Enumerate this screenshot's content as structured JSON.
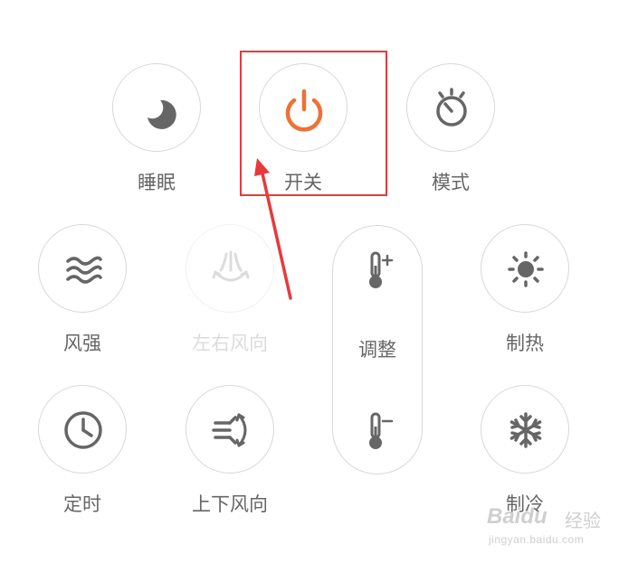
{
  "colors": {
    "icon_gray": "#7a7a7a",
    "power_orange": "#ec7236",
    "border_gray": "#d8d8d8",
    "disabled_gray": "#dcdcdc",
    "annotation_red": "#e8393d"
  },
  "controls": {
    "sleep": {
      "label": "睡眠",
      "icon": "moon-icon"
    },
    "power": {
      "label": "开关",
      "icon": "power-icon"
    },
    "mode": {
      "label": "模式",
      "icon": "stopwatch-icon"
    },
    "wind_strength": {
      "label": "风强",
      "icon": "wind-waves-icon"
    },
    "horizontal_swing": {
      "label": "左右风向",
      "icon": "horizontal-swing-icon",
      "disabled": true
    },
    "heat": {
      "label": "制热",
      "icon": "sun-icon"
    },
    "timer": {
      "label": "定时",
      "icon": "clock-icon"
    },
    "vertical_swing": {
      "label": "上下风向",
      "icon": "vertical-swing-icon"
    },
    "cool": {
      "label": "制冷",
      "icon": "snowflake-icon"
    },
    "temperature": {
      "label": "调整",
      "up_icon": "thermometer-plus-icon",
      "down_icon": "thermometer-minus-icon"
    }
  },
  "watermark": {
    "logo": "Baidu",
    "title": "经验",
    "url": "jingyan.baidu.com"
  }
}
